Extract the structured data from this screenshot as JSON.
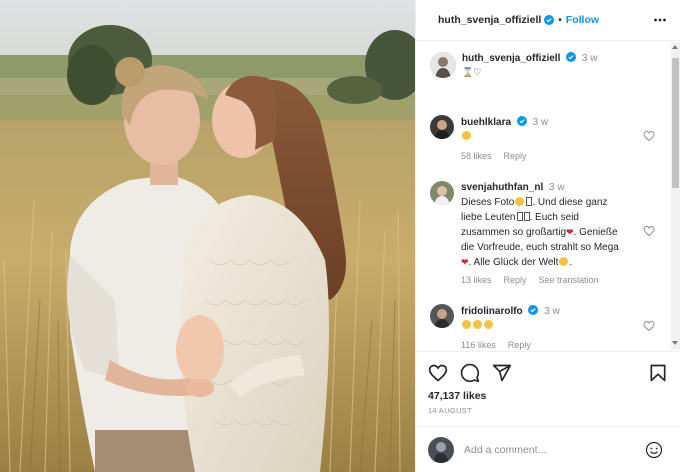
{
  "post": {
    "author": "huth_svenja_offiziell",
    "follow_label": "Follow",
    "separator": "•",
    "caption": {
      "username": "huth_svenja_offiziell",
      "time": "3 w"
    },
    "comments": [
      {
        "username": "buehlklara",
        "time": "3 w",
        "likes": "58 likes",
        "reply": "Reply"
      },
      {
        "username": "svenjahuthfan_nl",
        "time": "3 w",
        "lines": [
          "Dieses Foto",
          ". Und diese ganz",
          "liebe Leuten",
          ". Euch seid",
          "zusammen so großartig",
          ". Genieße",
          "die Vorfreude, euch strahlt so Mega",
          ". Alle Glück der Welt",
          "."
        ],
        "likes": "13 likes",
        "reply": "Reply",
        "translation": "See translation"
      },
      {
        "username": "fridolinarolfo",
        "time": "3 w",
        "likes": "116 likes",
        "reply": "Reply"
      }
    ],
    "like_count": "47,137 likes",
    "date": "14 AUGUST",
    "add_comment_placeholder": "Add a comment..."
  },
  "colors": {
    "accent": "#0095f6",
    "text": "#262626",
    "muted": "#8e8e8e",
    "heart": "#d6202f"
  },
  "icons": [
    "more-icon",
    "verified-icon",
    "heart-icon",
    "comment-icon",
    "share-icon",
    "bookmark-icon",
    "emoji-icon"
  ]
}
